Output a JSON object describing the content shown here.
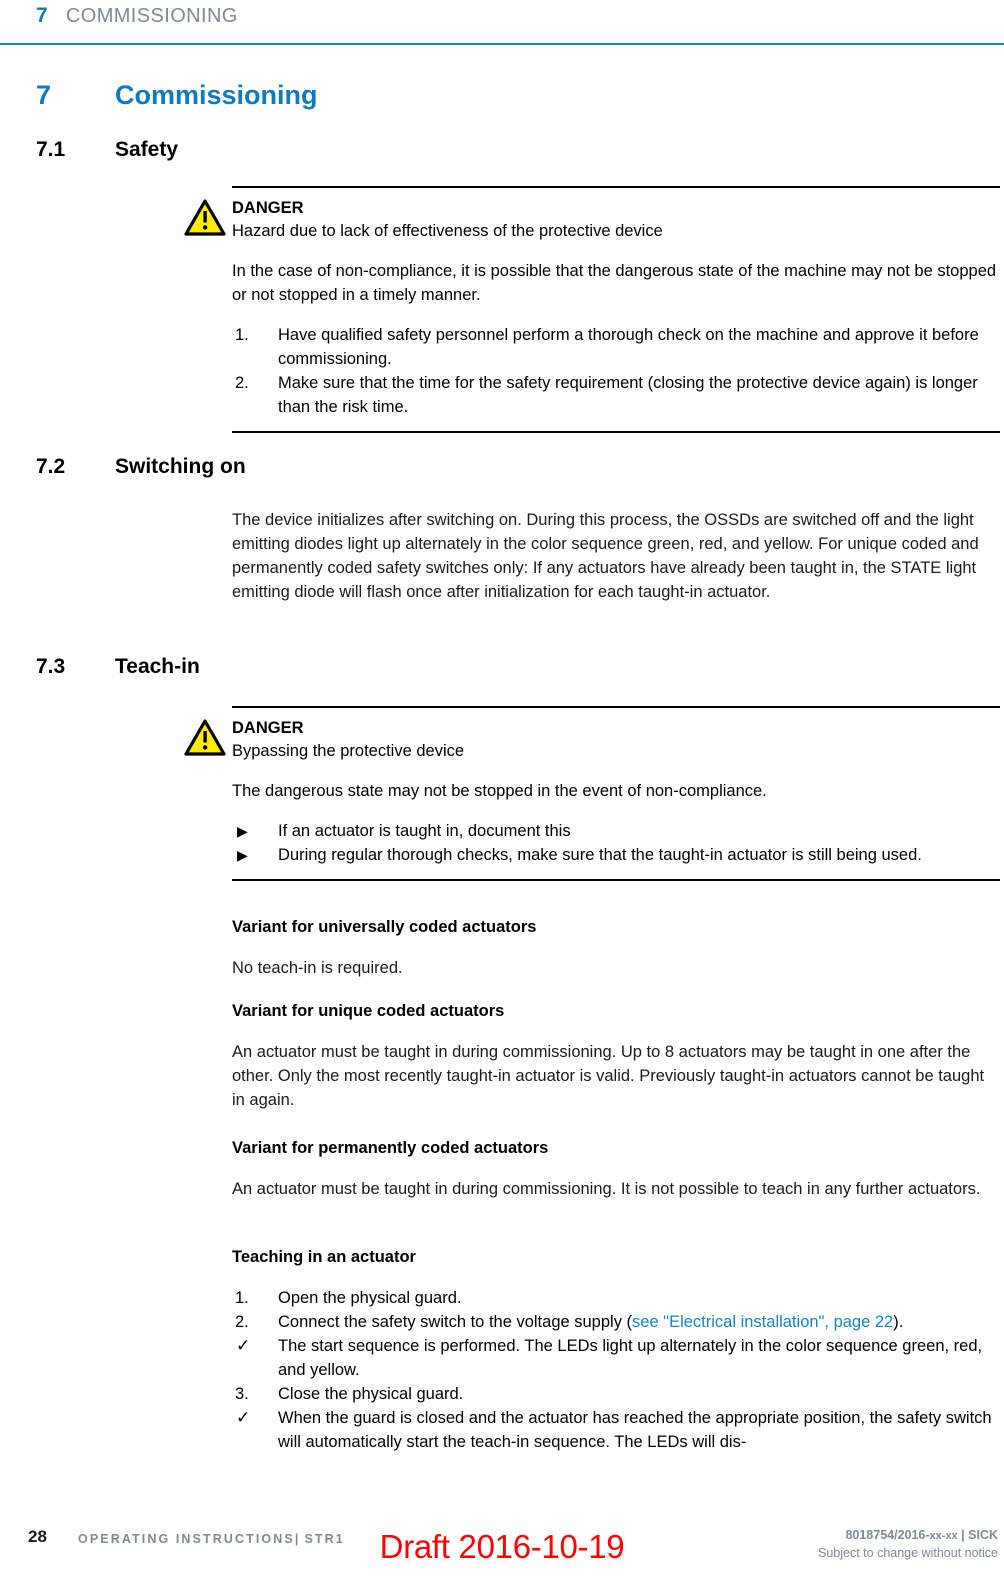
{
  "running_header": {
    "chapter_number": "7",
    "chapter_title": "COMMISSIONING"
  },
  "chapter": {
    "number": "7",
    "title": "Commissioning"
  },
  "sections": {
    "safety": {
      "number": "7.1",
      "title": "Safety",
      "danger": {
        "label": "DANGER",
        "subtitle": "Hazard due to lack of effectiveness of the protective device",
        "description": "In the case of non-compliance, it is possible that the dangerous state of the machine may not be stopped or not stopped in a timely manner.",
        "steps": [
          {
            "marker": "1.",
            "text": "Have qualified safety personnel perform a thorough check on the machine and approve it before commissioning."
          },
          {
            "marker": "2.",
            "text": "Make sure that the time for the safety requirement (closing the protective device again) is longer than the risk time."
          }
        ]
      }
    },
    "switching_on": {
      "number": "7.2",
      "title": "Switching on",
      "body": "The device initializes after switching on. During this process, the OSSDs are switched off and the light emitting diodes light up alternately in the color sequence green, red, and yellow. For unique coded and permanently coded safety switches only: If any actuators have already been taught in, the STATE light emitting diode will flash once after initialization for each taught-in actuator."
    },
    "teach_in": {
      "number": "7.3",
      "title": "Teach-in",
      "danger": {
        "label": "DANGER",
        "subtitle": "Bypassing the protective device",
        "description": "The dangerous state may not be stopped in the event of non-compliance.",
        "bullets": [
          {
            "marker": "▶",
            "text": "If an actuator is taught in, document this"
          },
          {
            "marker": "▶",
            "text": "During regular thorough checks, make sure that the taught-in actuator is still being used."
          }
        ]
      },
      "variants": [
        {
          "heading": "Variant for universally coded actuators",
          "body": "No teach-in is required."
        },
        {
          "heading": "Variant for unique coded actuators",
          "body": "An actuator must be taught in during commissioning. Up to 8 actuators may be taught in one after the other. Only the most recently taught-in actuator is valid. Previously taught-in actuators cannot be taught in again."
        },
        {
          "heading": "Variant for permanently coded actuators",
          "body": "An actuator must be taught in during commissioning. It is not possible to teach in any further actuators."
        }
      ],
      "procedure": {
        "heading": "Teaching in an actuator",
        "steps": [
          {
            "marker": "1.",
            "text": "Open the physical guard.",
            "link": null
          },
          {
            "marker": "2.",
            "text_before": "Connect the safety switch to the voltage supply (",
            "link_text": "see \"Electrical installation\", page 22",
            "text_after": ")."
          },
          {
            "marker": "✓",
            "text": "The start sequence is performed. The LEDs light up alternately in the color sequence green, red, and yellow."
          },
          {
            "marker": "3.",
            "text": "Close the physical guard."
          },
          {
            "marker": "✓",
            "text": "When the guard is closed and the actuator has reached the appropriate position, the safety switch will automatically start the teach-in sequence. The LEDs will dis-"
          }
        ]
      }
    }
  },
  "footer": {
    "page_number": "28",
    "doc_title": "OPERATING INSTRUCTIONS",
    "separator": "|",
    "product": "STR1",
    "doc_id_bold": "8018754/2016-",
    "doc_id_rest": "xx-xx",
    "doc_id_suffix": " | SICK",
    "disclaimer": "Subject to change without notice",
    "watermark": "Draft 2016-10-19"
  },
  "colors": {
    "brand_blue": "#1583c4",
    "heading_blue": "#0e7ac0",
    "footer_gray": "#7d8a93",
    "warning_yellow": "#ffed00",
    "draft_red": "#ff0000"
  }
}
